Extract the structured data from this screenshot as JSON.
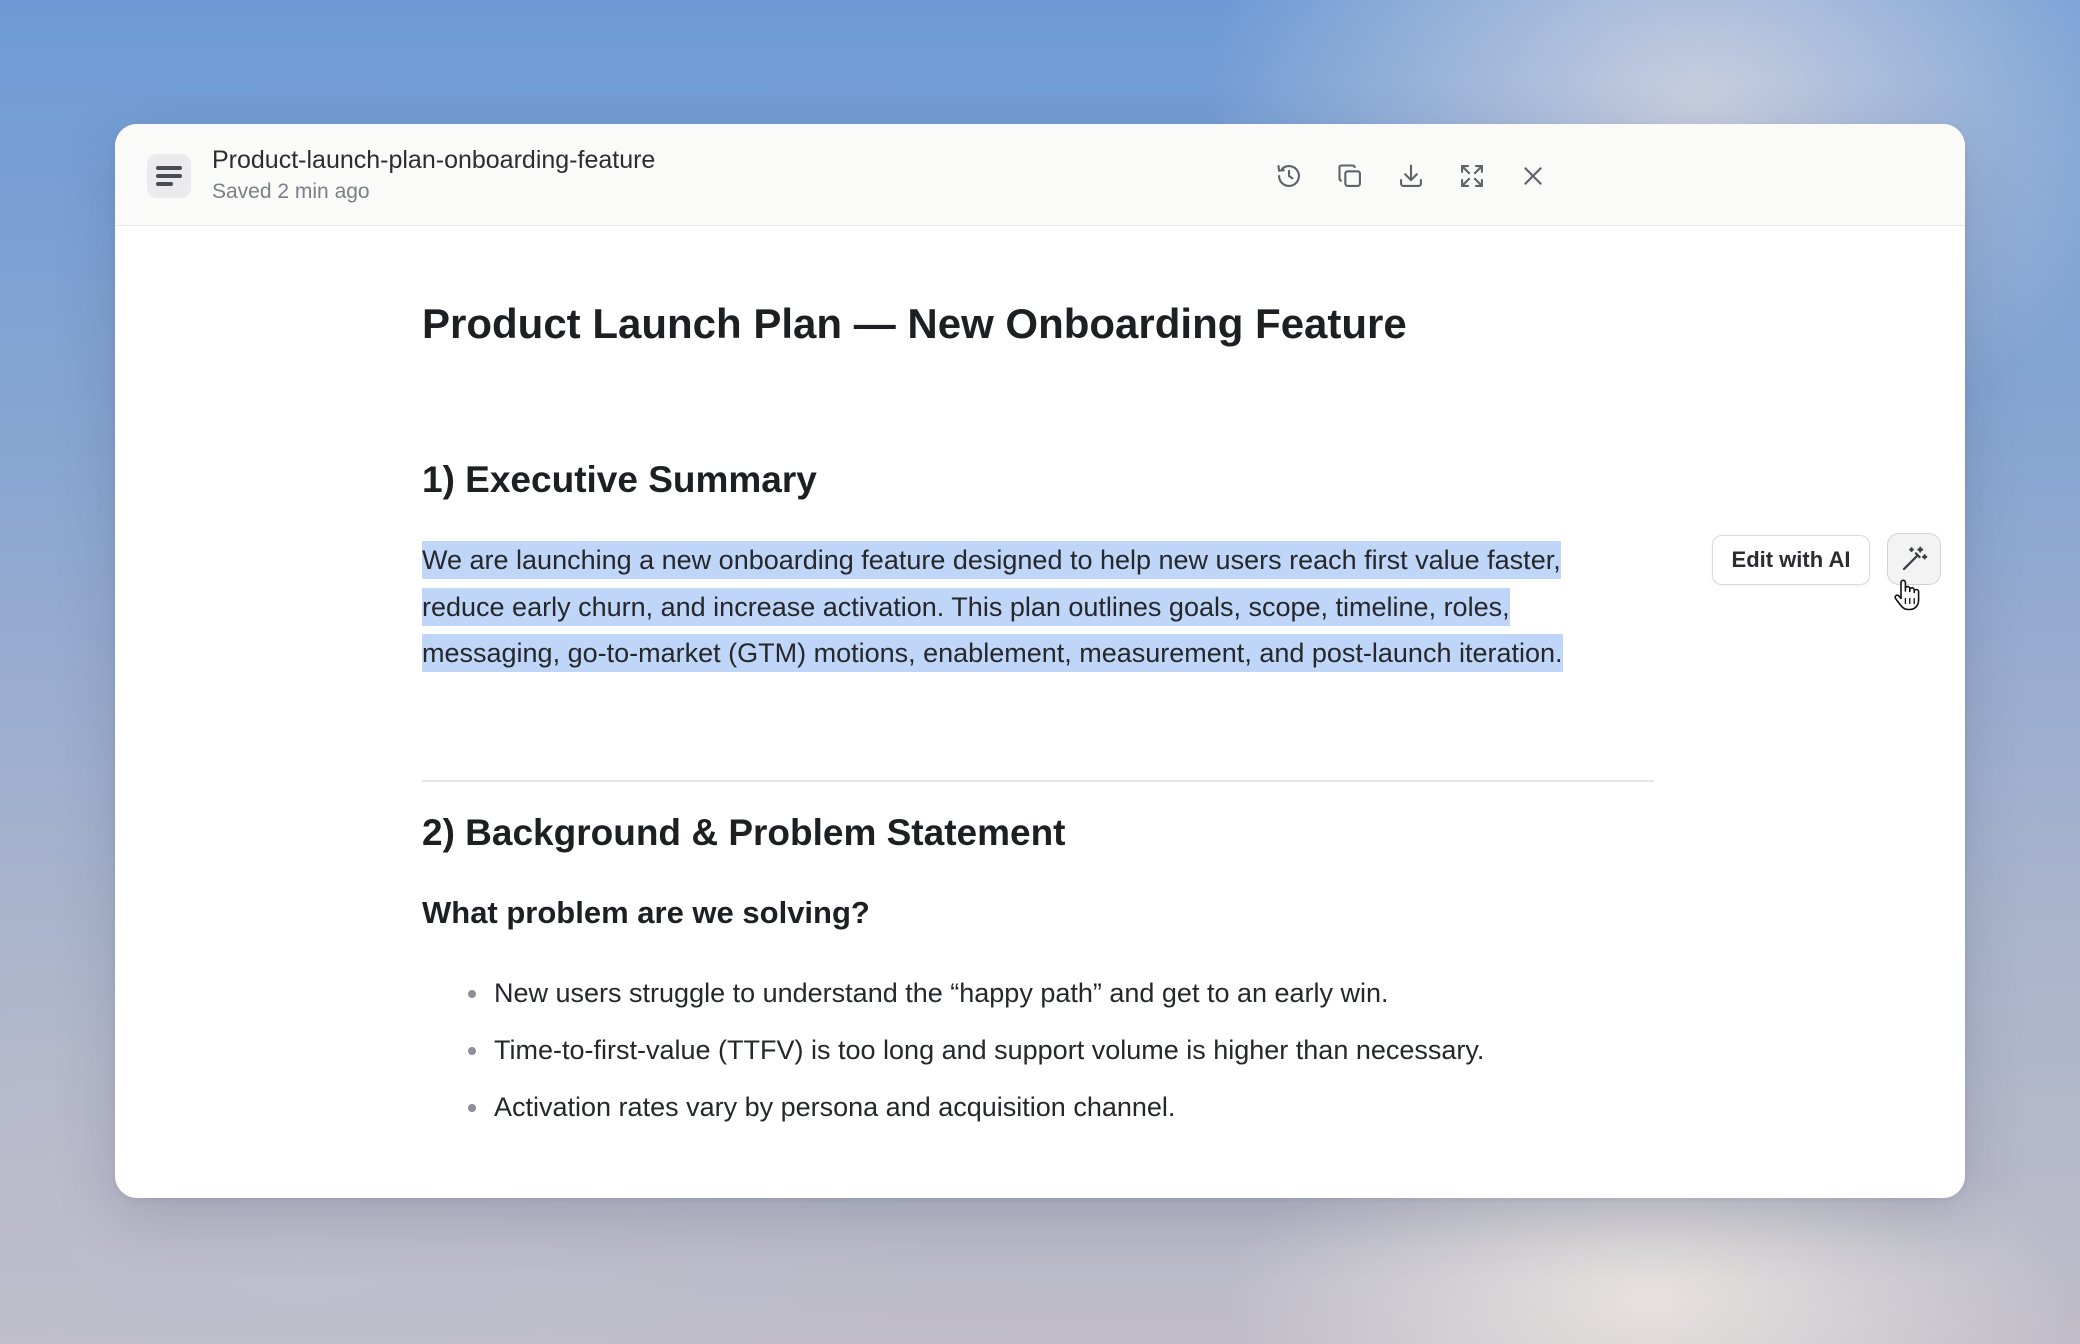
{
  "window": {
    "file_name": "Product-launch-plan-onboarding-feature",
    "status": "Saved 2 min ago",
    "toolbar": [
      {
        "name": "history-button",
        "icon": "history-icon"
      },
      {
        "name": "copy-button",
        "icon": "copy-icon"
      },
      {
        "name": "download-button",
        "icon": "download-icon"
      },
      {
        "name": "fullscreen-button",
        "icon": "expand-icon"
      },
      {
        "name": "close-button",
        "icon": "close-icon"
      }
    ]
  },
  "document": {
    "title": "Product Launch Plan — New Onboarding Feature",
    "section1": {
      "heading": "1) Executive Summary",
      "lines": [
        "We are launching a new onboarding feature designed to help new users reach first value faster,",
        "reduce early churn, and increase activation. This plan outlines goals, scope, timeline, roles,",
        "messaging, go-to-market (GTM) motions, enablement, measurement, and post-launch iteration."
      ]
    },
    "section2": {
      "heading": "2) Background & Problem Statement",
      "subheading": "What problem are we solving?",
      "bullets": [
        "New users struggle to understand the “happy path” and get to an early win.",
        "Time-to-first-value (TTFV) is too long and support volume is higher than necessary.",
        "Activation rates vary by persona and acquisition channel."
      ]
    }
  },
  "ai_toolbar": {
    "edit_label": "Edit with AI",
    "wand_icon": "magic-wand-icon"
  },
  "colors": {
    "selection": "#bfd6f8",
    "text": "#1d1f22"
  }
}
